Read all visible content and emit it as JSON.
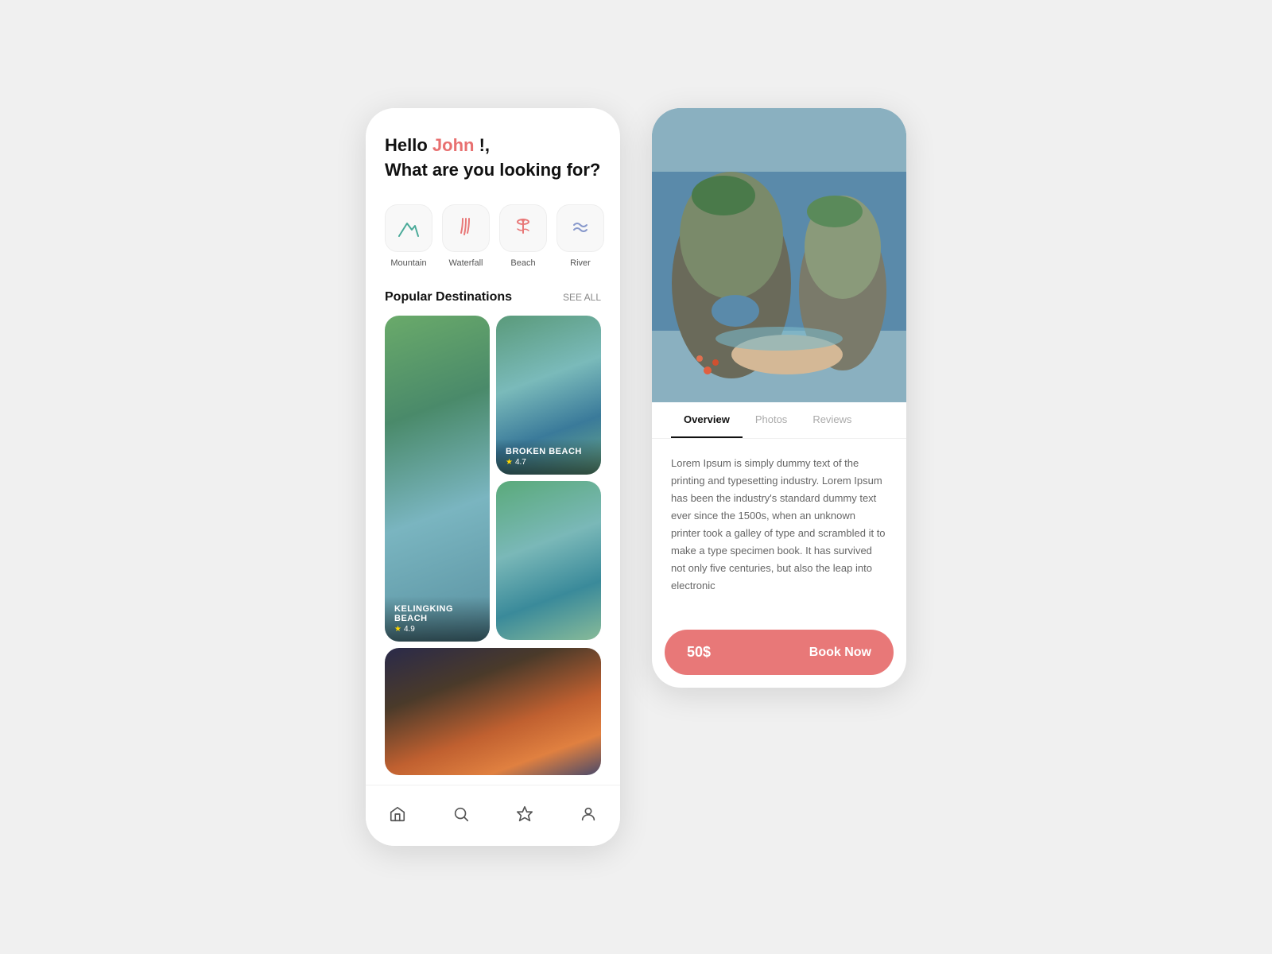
{
  "left_phone": {
    "greeting": {
      "prefix": "Hello ",
      "name": "John",
      "suffix": " !,",
      "subtitle": "What are you looking for?"
    },
    "categories": [
      {
        "id": "mountain",
        "label": "Mountain",
        "icon": "mountain"
      },
      {
        "id": "waterfall",
        "label": "Waterfall",
        "icon": "waterfall"
      },
      {
        "id": "beach",
        "label": "Beach",
        "icon": "beach"
      },
      {
        "id": "river",
        "label": "River",
        "icon": "river"
      }
    ],
    "section": {
      "title": "Popular Destinations",
      "see_all": "SEE ALL"
    },
    "destinations": [
      {
        "id": "kelingking",
        "name": "KELINGKING BEACH",
        "rating": "4.9",
        "img_class": "img-kelingking",
        "size": "large"
      },
      {
        "id": "broken",
        "name": "BROKEN BEACH",
        "rating": "4.7",
        "img_class": "img-broken-beach",
        "size": "small"
      },
      {
        "id": "sunset",
        "name": "",
        "rating": "",
        "img_class": "img-sunset",
        "size": "small"
      },
      {
        "id": "cliff",
        "name": "",
        "rating": "",
        "img_class": "img-cliff",
        "size": "small"
      }
    ],
    "nav": {
      "items": [
        "home",
        "search",
        "bookmark",
        "profile"
      ]
    }
  },
  "right_phone": {
    "tabs": [
      {
        "id": "overview",
        "label": "Overview",
        "active": true
      },
      {
        "id": "photos",
        "label": "Photos",
        "active": false
      },
      {
        "id": "reviews",
        "label": "Reviews",
        "active": false
      }
    ],
    "description": "Lorem Ipsum is simply dummy text of the printing and typesetting industry. Lorem Ipsum has been the industry's standard dummy text ever since the 1500s, when an unknown printer took a galley of type and scrambled it to make a type specimen book. It has survived not only five centuries, but also the leap into electronic",
    "price": "50$",
    "book_label": "Book Now"
  }
}
